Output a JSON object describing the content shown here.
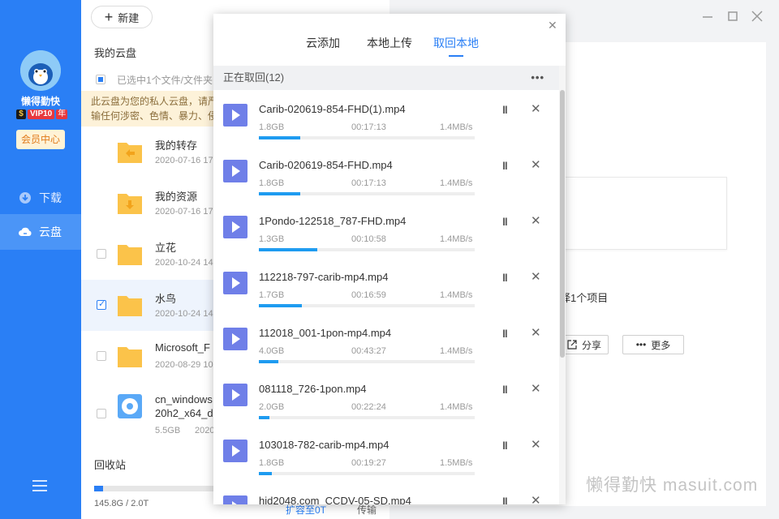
{
  "sidebar": {
    "username": "懒得勤快",
    "vip_s": "$",
    "vip_badge": "VIP10",
    "vip_year": "年",
    "member_center": "会员中心",
    "nav": [
      {
        "label": "下载",
        "icon": "download-icon"
      },
      {
        "label": "云盘",
        "icon": "cloud-icon"
      }
    ]
  },
  "filepanel": {
    "new_label": "新建",
    "my_cloud_label": "我的云盘",
    "select_text": "已选中1个文件/文件夹",
    "notice_line1": "此云盘为您的私人云盘，请严",
    "notice_line2": "输任何涉密、色情、暴力、侵",
    "files": [
      {
        "name": "我的转存",
        "date": "2020-07-16 17",
        "icon": "folder-transfer-icon",
        "checkbox": false,
        "selected": false
      },
      {
        "name": "我的资源",
        "date": "2020-07-16 17",
        "icon": "folder-download-icon",
        "checkbox": false,
        "selected": false
      },
      {
        "name": "立花",
        "date": "2020-10-24 14",
        "icon": "folder-icon",
        "checkbox": true,
        "selected": false
      },
      {
        "name": "水鸟",
        "date": "2020-10-24 14",
        "icon": "folder-icon",
        "checkbox": true,
        "selected": true
      },
      {
        "name": "Microsoft_F",
        "date": "2020-08-29 10",
        "icon": "folder-icon",
        "checkbox": true,
        "selected": false
      },
      {
        "name": "cn_windows",
        "name2": "20h2_x64_d",
        "size": "5.5GB",
        "date": "2020",
        "icon": "disc-image-icon",
        "checkbox": true,
        "selected": false
      }
    ],
    "recycle_label": "回收站",
    "storage_text": "145.8G / 2.0T",
    "storage_fraction": 0.071,
    "footer_partial": "扩容至0T",
    "footer_transfer": "传输"
  },
  "right": {
    "selected_text": "择1个项目",
    "share_label": "分享",
    "more_label": "更多",
    "watermark": "懒得勤快 masuit.com"
  },
  "popup": {
    "tabs": [
      "云添加",
      "本地上传",
      "取回本地"
    ],
    "active_tab": 2,
    "header": "正在取回(12)",
    "more": "•••",
    "items": [
      {
        "name": "Carib-020619-854-FHD(1).mp4",
        "size": "1.8GB",
        "time": "00:17:13",
        "speed": "1.4MB/s",
        "progress": 0.19
      },
      {
        "name": "Carib-020619-854-FHD.mp4",
        "size": "1.8GB",
        "time": "00:17:13",
        "speed": "1.4MB/s",
        "progress": 0.19
      },
      {
        "name": "1Pondo-122518_787-FHD.mp4",
        "size": "1.3GB",
        "time": "00:10:58",
        "speed": "1.4MB/s",
        "progress": 0.27
      },
      {
        "name": "112218-797-carib-mp4.mp4",
        "size": "1.7GB",
        "time": "00:16:59",
        "speed": "1.4MB/s",
        "progress": 0.2
      },
      {
        "name": "112018_001-1pon-mp4.mp4",
        "size": "4.0GB",
        "time": "00:43:27",
        "speed": "1.4MB/s",
        "progress": 0.09
      },
      {
        "name": "081118_726-1pon.mp4",
        "size": "2.0GB",
        "time": "00:22:24",
        "speed": "1.4MB/s",
        "progress": 0.05
      },
      {
        "name": "103018-782-carib-mp4.mp4",
        "size": "1.8GB",
        "time": "00:19:27",
        "speed": "1.5MB/s",
        "progress": 0.06
      },
      {
        "name": "hjd2048.com_CCDV-05-SD.mp4",
        "size": "",
        "time": "",
        "speed": "",
        "progress": 0
      }
    ]
  },
  "colors": {
    "sidebar_blue": "#2a7ff5",
    "accent": "#2a7ff5",
    "progress": "#1e9bf0",
    "play_icon": "#6f7fe8"
  }
}
